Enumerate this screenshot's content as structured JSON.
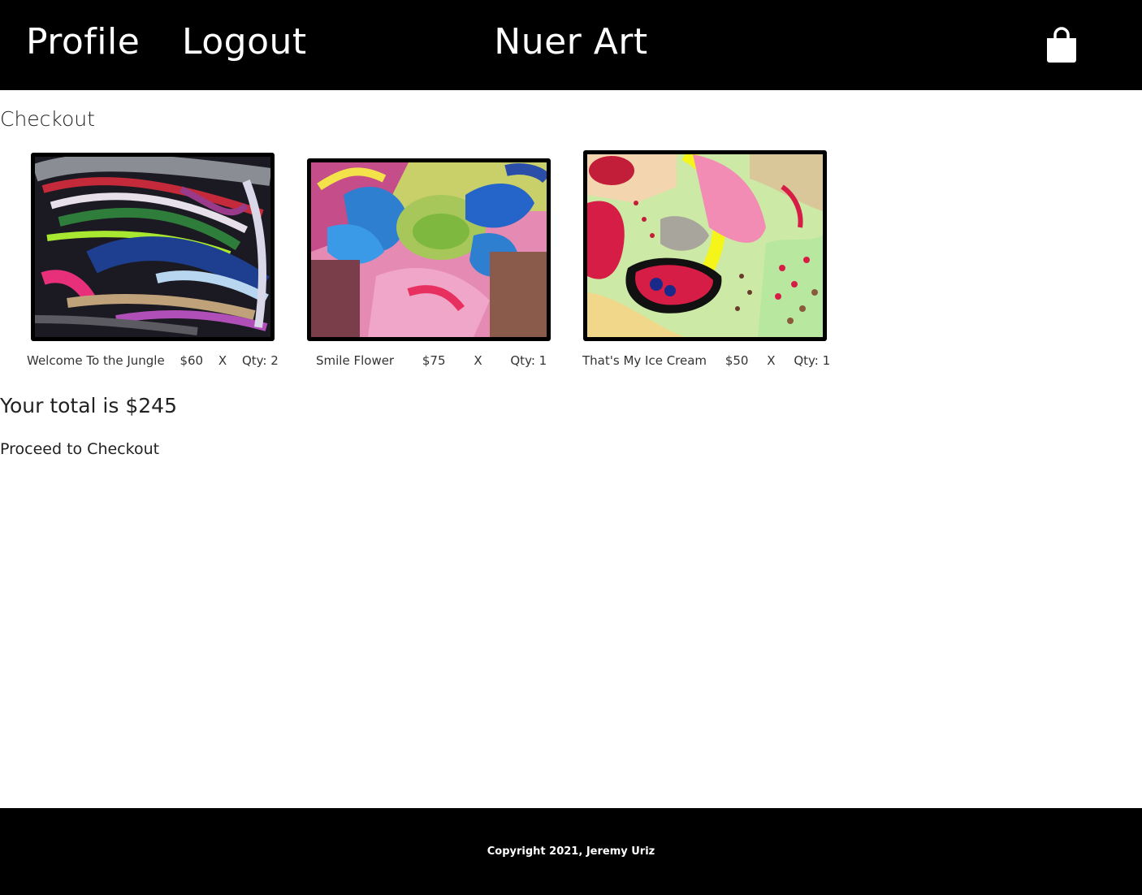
{
  "header": {
    "profile_label": "Profile",
    "logout_label": "Logout",
    "brand": "Nuer Art",
    "cart_icon": "shopping-bag-icon"
  },
  "checkout": {
    "heading": "Checkout",
    "items": [
      {
        "title": "Welcome To the Jungle",
        "price": "$60",
        "remove": "X",
        "qty": "Qty: 2"
      },
      {
        "title": "Smile Flower",
        "price": "$75",
        "remove": "X",
        "qty": "Qty: 1"
      },
      {
        "title": "That's My Ice Cream",
        "price": "$50",
        "remove": "X",
        "qty": "Qty: 1"
      }
    ],
    "total": "Your total is $245",
    "proceed_label": "Proceed to Checkout"
  },
  "footer": {
    "copyright": "Copyright 2021, Jeremy Uriz"
  },
  "colors": {
    "header_bg": "#000000",
    "footer_bg": "#000000",
    "text": "#222222"
  }
}
